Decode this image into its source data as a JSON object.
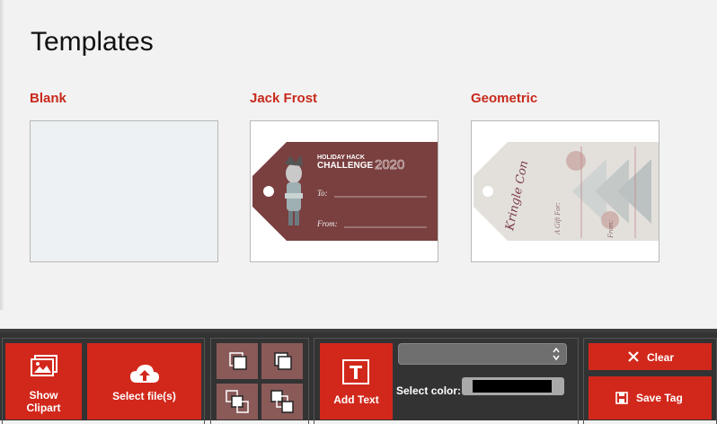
{
  "page": {
    "title": "Templates"
  },
  "templates": [
    {
      "label": "Blank"
    },
    {
      "label": "Jack Frost",
      "tag": {
        "line1": "HOLIDAY HACK",
        "line2": "CHALLENGE",
        "year": "2020",
        "to": "To:",
        "from": "From:"
      }
    },
    {
      "label": "Geometric",
      "tag": {
        "script": "Kringle Con",
        "gift": "A Gift For:",
        "from": "From:"
      }
    }
  ],
  "toolbar": {
    "show_clipart": "Show Clipart",
    "select_files": "Select file(s)",
    "add_text": "Add Text",
    "select_color_label": "Select color:",
    "font_select_value": "",
    "color_value": "#000000",
    "clear": "Clear",
    "save_tag": "Save Tag"
  },
  "colors": {
    "accent": "#d2281c",
    "label_red": "#c8291c",
    "toolbar_bg": "#333333"
  }
}
